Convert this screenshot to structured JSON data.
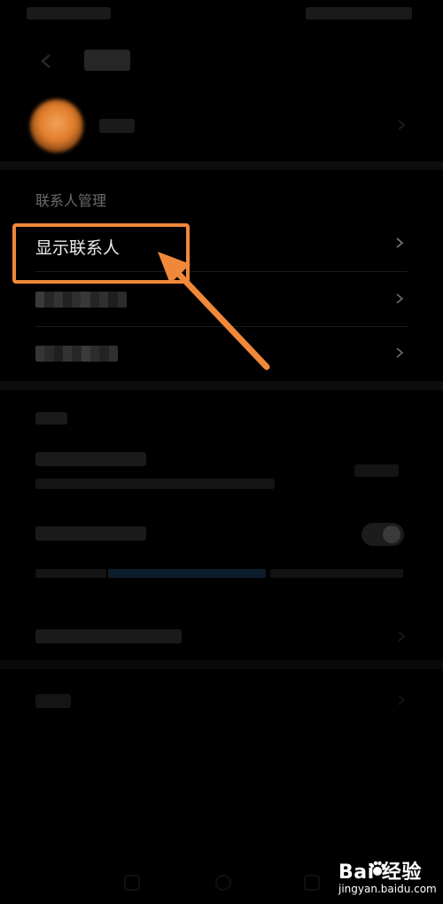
{
  "section_contacts": {
    "header": "联系人管理",
    "items": [
      {
        "label": "显示联系人"
      }
    ]
  },
  "colors": {
    "accent": "#f0883a",
    "background": "#000000",
    "text": "#e6e6e6",
    "muted": "#8a8a8a"
  },
  "icons": {
    "back": "arrow-left-icon",
    "chevron": "chevron-right-icon"
  },
  "watermark": {
    "brand": "Bai 经验",
    "url": "jingyan.baidu.com"
  }
}
